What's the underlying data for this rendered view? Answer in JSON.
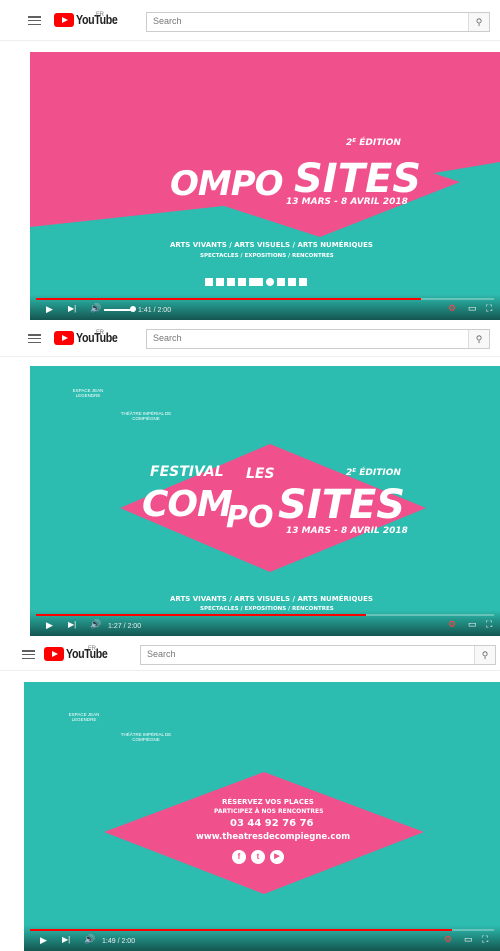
{
  "header": {
    "brand": "YouTube",
    "region": "FR",
    "search_placeholder": "Search",
    "search_icon": "search-icon",
    "menu_icon": "hamburger-menu-icon"
  },
  "frames": [
    {
      "time": "1:41 / 2:00",
      "progress": 0.84,
      "edition": "2ᴱ ÉDITION",
      "title_left": "OMPO",
      "title_right": "SITES",
      "dates": "13 MARS - 8 AVRIL 2018",
      "tagline1": "ARTS VIVANTS / ARTS VISUELS / ARTS NUMÉRIQUES",
      "tagline2": "SPECTACLES / EXPOSITIONS / RENCONTRES"
    },
    {
      "time": "1:27 / 2:00",
      "progress": 0.72,
      "festival": "FESTIVAL",
      "les": "LES",
      "edition": "2ᴱ ÉDITION",
      "title_left": "COM",
      "title_mid": "PO",
      "title_right": "SITES",
      "dates": "13 MARS - 8 AVRIL 2018",
      "tagline1": "ARTS VIVANTS / ARTS VISUELS / ARTS NUMÉRIQUES",
      "tagline2": "SPECTACLES / EXPOSITIONS / RENCONTRES",
      "logo_left": "ESPACE JEAN LEGENDRE",
      "logo_right": "THÉÂTRE IMPÉRIAL DE COMPIÈGNE"
    },
    {
      "time": "1:49 / 2:00",
      "progress": 0.91,
      "line1": "RÉSERVEZ VOS PLACES",
      "line2": "PARTICIPEZ À NOS RENCONTRES",
      "phone": "03 44 92 76 76",
      "url": "www.theatresdecompiegne.com",
      "logo_left": "ESPACE JEAN LEGENDRE",
      "logo_right": "THÉÂTRE IMPÉRIAL DE COMPIÈGNE",
      "social": [
        "facebook-icon",
        "twitter-icon",
        "youtube-icon"
      ]
    }
  ],
  "colors": {
    "teal": "#2dbdb0",
    "pink": "#f0508c",
    "red": "#ff0000"
  }
}
